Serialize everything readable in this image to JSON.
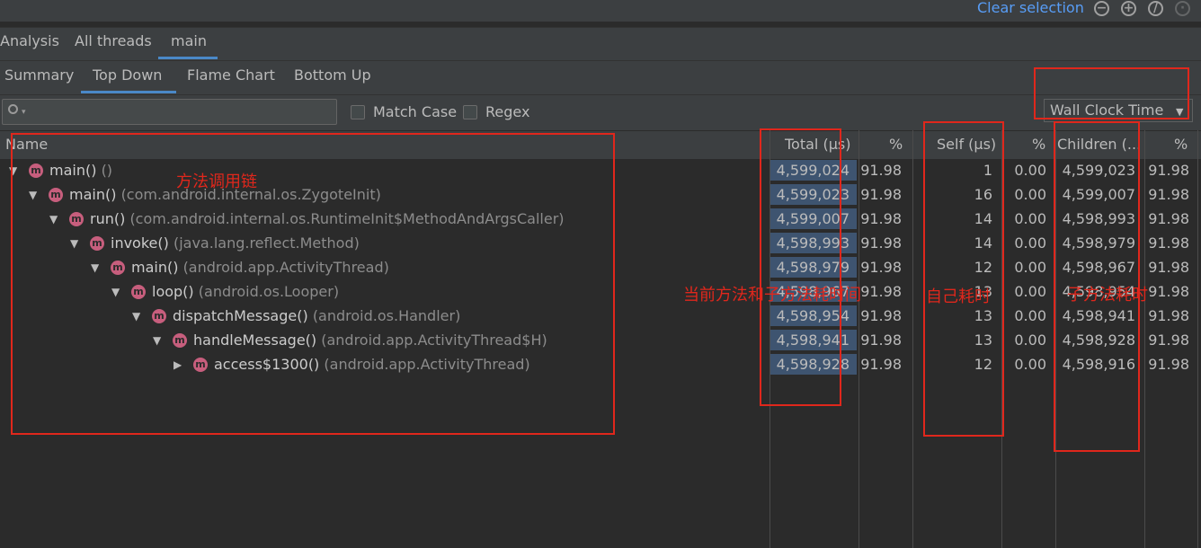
{
  "toolbar": {
    "clear_selection": "Clear selection",
    "icons": [
      "zoom-out-icon",
      "zoom-in-icon",
      "reset-zoom-icon",
      "expand-icon"
    ]
  },
  "thread_tabs": [
    "Analysis",
    "All threads",
    "main"
  ],
  "view_tabs": [
    "Summary",
    "Top Down",
    "Flame Chart",
    "Bottom Up"
  ],
  "filter": {
    "search_placeholder": "",
    "match_case": "Match Case",
    "regex": "Regex",
    "clock": "Wall Clock Time"
  },
  "columns": {
    "name": "Name",
    "total": "Total (μs)",
    "total_pct": "%",
    "self": "Self (μs)",
    "self_pct": "%",
    "children": "Children (...",
    "children_pct": "%"
  },
  "rows": [
    {
      "method": "main()",
      "pkg": "()",
      "total": "4,599,024",
      "total_pct": "91.98",
      "self": "1",
      "self_pct": "0.00",
      "children": "4,599,023",
      "children_pct": "91.98"
    },
    {
      "method": "main()",
      "pkg": "(com.android.internal.os.ZygoteInit)",
      "total": "4,599,023",
      "total_pct": "91.98",
      "self": "16",
      "self_pct": "0.00",
      "children": "4,599,007",
      "children_pct": "91.98"
    },
    {
      "method": "run()",
      "pkg": "(com.android.internal.os.RuntimeInit$MethodAndArgsCaller)",
      "total": "4,599,007",
      "total_pct": "91.98",
      "self": "14",
      "self_pct": "0.00",
      "children": "4,598,993",
      "children_pct": "91.98"
    },
    {
      "method": "invoke()",
      "pkg": "(java.lang.reflect.Method)",
      "total": "4,598,993",
      "total_pct": "91.98",
      "self": "14",
      "self_pct": "0.00",
      "children": "4,598,979",
      "children_pct": "91.98"
    },
    {
      "method": "main()",
      "pkg": "(android.app.ActivityThread)",
      "total": "4,598,979",
      "total_pct": "91.98",
      "self": "12",
      "self_pct": "0.00",
      "children": "4,598,967",
      "children_pct": "91.98"
    },
    {
      "method": "loop()",
      "pkg": "(android.os.Looper)",
      "total": "4,598,967",
      "total_pct": "91.98",
      "self": "13",
      "self_pct": "0.00",
      "children": "4,598,954",
      "children_pct": "91.98"
    },
    {
      "method": "dispatchMessage()",
      "pkg": "(android.os.Handler)",
      "total": "4,598,954",
      "total_pct": "91.98",
      "self": "13",
      "self_pct": "0.00",
      "children": "4,598,941",
      "children_pct": "91.98"
    },
    {
      "method": "handleMessage()",
      "pkg": "(android.app.ActivityThread$H)",
      "total": "4,598,941",
      "total_pct": "91.98",
      "self": "13",
      "self_pct": "0.00",
      "children": "4,598,928",
      "children_pct": "91.98"
    },
    {
      "method": "access$1300()",
      "pkg": "(android.app.ActivityThread)",
      "total": "4,598,928",
      "total_pct": "91.98",
      "self": "12",
      "self_pct": "0.00",
      "children": "4,598,916",
      "children_pct": "91.98"
    }
  ],
  "annotations": {
    "call_chain": "方法调用链",
    "total_time": "当前方法和子方法耗时间",
    "self_time": "自己耗时",
    "children_time": "子方法耗时"
  },
  "colors": {
    "accent": "#4a88c7",
    "link": "#589df6",
    "annotation": "#e0271c",
    "method_icon": "#c75e7d",
    "total_bar": "#3e5470"
  }
}
